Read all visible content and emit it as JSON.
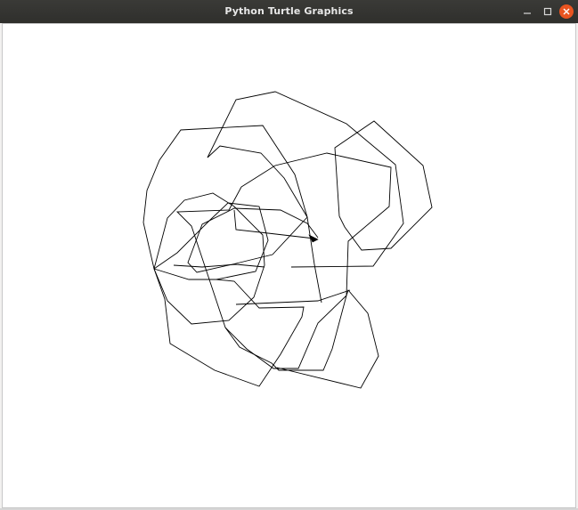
{
  "window": {
    "title": "Python Turtle Graphics",
    "controls": {
      "minimize_icon": "minimize-icon",
      "maximize_icon": "maximize-icon",
      "close_icon": "close-icon",
      "close_color": "#e95420"
    }
  },
  "canvas": {
    "background": "#ffffff",
    "pen_color": "#000000"
  }
}
